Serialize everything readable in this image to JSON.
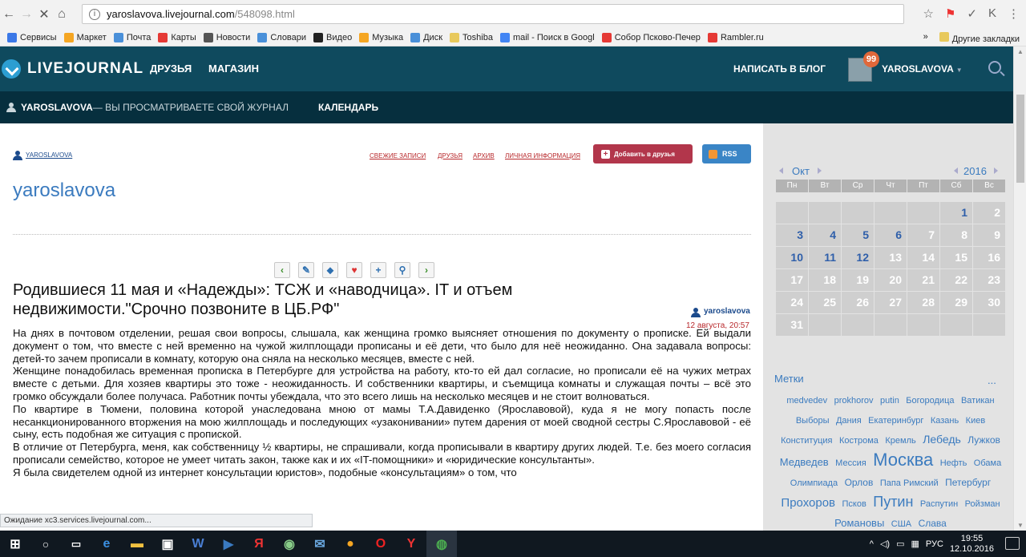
{
  "browser": {
    "url_domain": "yaroslavova.livejournal.com",
    "url_path": "/548098.html",
    "bookmarks": [
      {
        "label": "Сервисы",
        "color": "#3b78e7"
      },
      {
        "label": "Маркет",
        "color": "#f5a623"
      },
      {
        "label": "Почта",
        "color": "#4a90d9"
      },
      {
        "label": "Карты",
        "color": "#e53935"
      },
      {
        "label": "Новости",
        "color": "#555555"
      },
      {
        "label": "Словари",
        "color": "#4a90d9"
      },
      {
        "label": "Видео",
        "color": "#222222"
      },
      {
        "label": "Музыка",
        "color": "#f5a623"
      },
      {
        "label": "Диск",
        "color": "#4a90d9"
      },
      {
        "label": "Toshiba",
        "color": "#e8c95c"
      },
      {
        "label": "mail - Поиск в Googl",
        "color": "#4285f4"
      },
      {
        "label": "Собор Псково-Печер",
        "color": "#e53935"
      },
      {
        "label": "Rambler.ru",
        "color": "#e53935"
      }
    ],
    "more": "»",
    "other_bookmarks": "Другие закладки",
    "status": "Ожидание xc3.services.livejournal.com..."
  },
  "lj": {
    "logo": "LIVEJOURNAL",
    "nav": [
      "ДРУЗЬЯ",
      "МАГАЗИН"
    ],
    "write": "НАПИСАТЬ В БЛОГ",
    "badge": "99",
    "user": "YAROSLAVOVA",
    "sub_user": "YAROSLAVOVA",
    "sub_text": " — ВЫ ПРОСМАТРИВАЕТЕ СВОЙ ЖУРНАЛ",
    "calendar": "КАЛЕНДАРЬ"
  },
  "journal": {
    "small_user": "YAROSLAVOVA",
    "topnav": [
      "СВЕЖИЕ ЗАПИСИ",
      "ДРУЗЬЯ",
      "АРХИВ",
      "ЛИЧНАЯ ИНФОРМАЦИЯ"
    ],
    "add_friend": "Добавить в друзья",
    "rss": "RSS",
    "title": "yaroslavova"
  },
  "post": {
    "title": "Родившиеся 11 мая и «Надежды»: ТСЖ и «наводчица». IT и отъем недвижимости.\"Срочно позвоните в ЦБ.РФ\"",
    "author": "yaroslavova",
    "date": "12 августа, 20:57",
    "tools": [
      {
        "g": "‹",
        "c": "#3a8f2a"
      },
      {
        "g": "✎",
        "c": "#2d6fb0"
      },
      {
        "g": "⬥",
        "c": "#2d6fb0"
      },
      {
        "g": "♥",
        "c": "#d33"
      },
      {
        "g": "+",
        "c": "#2d6fb0"
      },
      {
        "g": "⚲",
        "c": "#2d6fb0"
      },
      {
        "g": "›",
        "c": "#3a8f2a"
      }
    ],
    "paragraphs": [
      "На днях в почтовом отделении, решая свои вопросы, слышала, как женщина громко выясняет отношения по документу о прописке. Ей выдали документ о том, что вместе с ней временно на чужой жилплощади прописаны и её дети, что было для неё неожиданно. Она задавала вопросы: детей-то зачем прописали в комнату, которую она сняла на несколько месяцев, вместе с ней.",
      "Женщине понадобилась временная прописка в Петербурге для устройства на работу, кто-то ей дал согласие, но прописали её на чужих метрах вместе с детьми. Для хозяев квартиры это тоже - неожиданность. И собственники квартиры, и съемщица комнаты и служащая почты – всё это громко обсуждали более получаса. Работник почты убеждала, что это всего лишь на несколько месяцев и не стоит волноваться.",
      "По квартире в Тюмени, половина которой унаследована мною от мамы Т.А.Давиденко (Ярославовой), куда я не могу попасть после несанкционированного вторжения на мою жилплощадь и последующих «узаконивании» путем дарения от моей сводной сестры С.Ярославовой - её сыну, есть подобная же ситуация с пропиской.",
      "В отличие от Петербурга, меня, как собственницу ½ квартиры, не спрашивали, когда прописывали в квартиру других людей. Т.е. без моего согласия прописали семейство, которое не умеет читать закон, также как и их «IT-помощники» и «юридические консультанты».",
      "Я была свидетелем одной из интернет консультации юристов», подобные «консультациям» о том, что"
    ]
  },
  "sidebar": {
    "month": "Окт",
    "year": "2016",
    "weekdays": [
      "Пн",
      "Вт",
      "Ср",
      "Чт",
      "Пт",
      "Сб",
      "Вс"
    ],
    "days": [
      [
        "",
        "",
        ""
      ],
      [
        "",
        "",
        ""
      ],
      [
        "",
        "",
        ""
      ],
      [
        "",
        "",
        ""
      ],
      [
        "",
        "",
        ""
      ],
      [
        "1",
        "1",
        ""
      ],
      [
        "2",
        "",
        ""
      ],
      [
        "3",
        "1",
        ""
      ],
      [
        "4",
        "1",
        ""
      ],
      [
        "5",
        "1",
        ""
      ],
      [
        "6",
        "1",
        ""
      ],
      [
        "7",
        "",
        ""
      ],
      [
        "8",
        "",
        ""
      ],
      [
        "9",
        "",
        ""
      ],
      [
        "10",
        "1",
        ""
      ],
      [
        "11",
        "1",
        ""
      ],
      [
        "12",
        "1",
        ""
      ],
      [
        "13",
        "",
        ""
      ],
      [
        "14",
        "",
        ""
      ],
      [
        "15",
        "",
        ""
      ],
      [
        "16",
        "",
        ""
      ],
      [
        "17",
        "",
        ""
      ],
      [
        "18",
        "",
        ""
      ],
      [
        "19",
        "",
        ""
      ],
      [
        "20",
        "",
        ""
      ],
      [
        "21",
        "",
        ""
      ],
      [
        "22",
        "",
        ""
      ],
      [
        "23",
        "",
        ""
      ],
      [
        "24",
        "",
        ""
      ],
      [
        "25",
        "",
        ""
      ],
      [
        "26",
        "",
        ""
      ],
      [
        "27",
        "",
        ""
      ],
      [
        "28",
        "",
        ""
      ],
      [
        "29",
        "",
        ""
      ],
      [
        "30",
        "",
        ""
      ],
      [
        "31",
        "",
        ""
      ],
      [
        "",
        "",
        ""
      ],
      [
        "",
        "",
        ""
      ],
      [
        "",
        "",
        ""
      ],
      [
        "",
        "",
        ""
      ],
      [
        "",
        "",
        ""
      ],
      [
        "",
        "",
        ""
      ]
    ],
    "tags_title": "Метки",
    "tags_more": "...",
    "tags": [
      {
        "t": "medvedev",
        "s": 11
      },
      {
        "t": "prokhorov",
        "s": 11
      },
      {
        "t": "putin",
        "s": 11
      },
      {
        "t": "Богородица",
        "s": 11
      },
      {
        "t": "Ватикан",
        "s": 11
      },
      {
        "t": "Выборы",
        "s": 11
      },
      {
        "t": "Дания",
        "s": 11
      },
      {
        "t": "Екатеринбург",
        "s": 11
      },
      {
        "t": "Казань",
        "s": 11
      },
      {
        "t": "Киев",
        "s": 11
      },
      {
        "t": "Конституция",
        "s": 11
      },
      {
        "t": "Кострома",
        "s": 11
      },
      {
        "t": "Кремль",
        "s": 11
      },
      {
        "t": "Лебедь",
        "s": 14
      },
      {
        "t": "Лужков",
        "s": 12
      },
      {
        "t": "Медведев",
        "s": 13
      },
      {
        "t": "Мессия",
        "s": 11
      },
      {
        "t": "Москва",
        "s": 22
      },
      {
        "t": "Нефть",
        "s": 11
      },
      {
        "t": "Обама",
        "s": 11
      },
      {
        "t": "Олимпиада",
        "s": 11
      },
      {
        "t": "Орлов",
        "s": 12
      },
      {
        "t": "Папа Римский",
        "s": 11
      },
      {
        "t": "Петербург",
        "s": 12
      },
      {
        "t": "Прохоров",
        "s": 15
      },
      {
        "t": "Псков",
        "s": 11
      },
      {
        "t": "Путин",
        "s": 18
      },
      {
        "t": "Распутин",
        "s": 11
      },
      {
        "t": "Ройзман",
        "s": 11
      },
      {
        "t": "Романовы",
        "s": 13
      },
      {
        "t": "США",
        "s": 11
      },
      {
        "t": "Слава",
        "s": 12
      }
    ]
  },
  "taskbar": {
    "lang": "РУС",
    "time": "19:55",
    "date": "12.10.2016"
  }
}
